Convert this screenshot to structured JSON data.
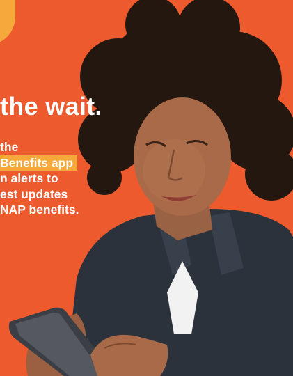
{
  "headline": "the wait.",
  "body_lines": [
    "the",
    "Benefits app",
    "n alerts to",
    "est updates",
    "NAP benefits."
  ],
  "colors": {
    "background": "#ec5a2e",
    "accent": "#f7a83a",
    "text": "#ffffff"
  },
  "image": {
    "subject": "person-using-smartphone-photo"
  }
}
